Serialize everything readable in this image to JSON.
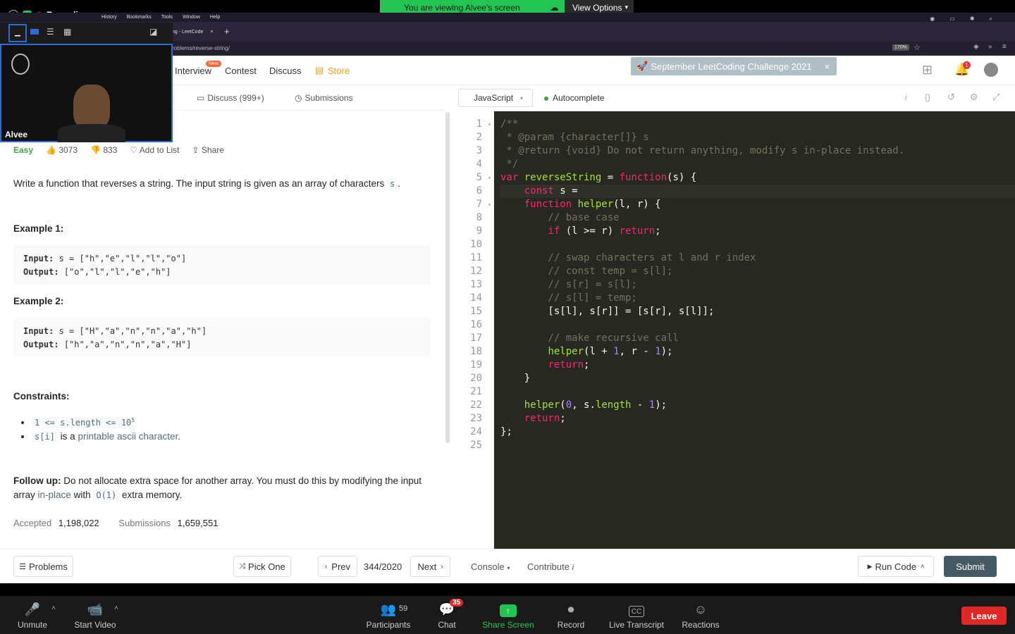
{
  "zoom_top": {
    "viewing_banner": "You are viewing Alvee's screen",
    "view_options": "View Options",
    "recording": "Recording"
  },
  "mac_menu": [
    "History",
    "Bookmarks",
    "Tools",
    "Window",
    "Help"
  ],
  "browser": {
    "tab_title": "ng - LeetCode",
    "url": "roblems/reverse-string/",
    "zoom": "170%"
  },
  "video": {
    "name": "Alvee"
  },
  "nav": {
    "interview": "Interview",
    "new_badge": "New",
    "contest": "Contest",
    "discuss": "Discuss",
    "store": "Store",
    "notification_count": "1",
    "promo": "September LeetCoding Challenge 2021"
  },
  "problem_tabs": {
    "discuss": "Discuss (999+)",
    "submissions": "Submissions"
  },
  "problem": {
    "difficulty": "Easy",
    "likes": "3073",
    "dislikes": "833",
    "add_to_list": "Add to List",
    "share": "Share",
    "description": "Write a function that reverses a string. The input string is given as an array of characters",
    "desc_code": "s",
    "desc_end": ".",
    "example1_title": "Example 1:",
    "ex1_input_label": "Input:",
    "ex1_input": "s = [\"h\",\"e\",\"l\",\"l\",\"o\"]",
    "ex1_output_label": "Output:",
    "ex1_output": "[\"o\",\"l\",\"l\",\"e\",\"h\"]",
    "example2_title": "Example 2:",
    "ex2_input_label": "Input:",
    "ex2_input": "s = [\"H\",\"a\",\"n\",\"n\",\"a\",\"h\"]",
    "ex2_output_label": "Output:",
    "ex2_output": "[\"h\",\"a\",\"n\",\"n\",\"a\",\"H\"]",
    "constraints_title": "Constraints:",
    "c1": "1 <= s.length <= 10",
    "c1_sup": "5",
    "c2_code": "s[i]",
    "c2_text": "is a",
    "c2_link": "printable ascii character",
    "c2_end": ".",
    "followup_label": "Follow up:",
    "followup_text": "Do not allocate extra space for another array. You must do this by modifying the input array",
    "followup_link": "in-place",
    "followup_with": "with",
    "followup_code": "O(1)",
    "followup_end": "extra memory.",
    "accepted_label": "Accepted",
    "accepted": "1,198,022",
    "submissions_label": "Submissions",
    "submissions": "1,659,551"
  },
  "editor": {
    "language": "JavaScript",
    "autocomplete": "Autocomplete"
  },
  "bottom": {
    "problems": "Problems",
    "pick_one": "Pick One",
    "prev": "Prev",
    "page": "344/2020",
    "next": "Next",
    "console": "Console",
    "contribute": "Contribute",
    "run_code": "Run Code",
    "submit": "Submit"
  },
  "zoom_controls": {
    "unmute": "Unmute",
    "start_video": "Start Video",
    "participants": "Participants",
    "participants_count": "59",
    "chat": "Chat",
    "chat_count": "35",
    "share_screen": "Share Screen",
    "record": "Record",
    "live_transcript": "Live Transcript",
    "reactions": "Reactions",
    "leave": "Leave"
  }
}
